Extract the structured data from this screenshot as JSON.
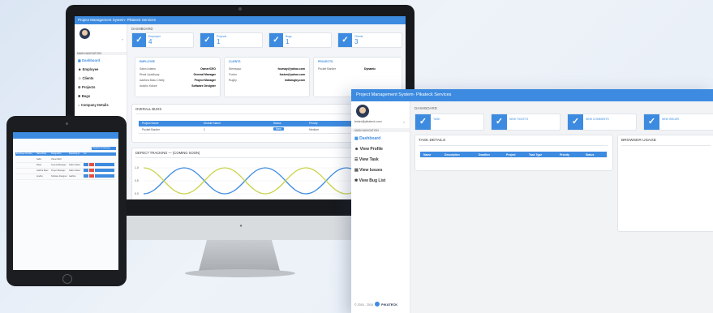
{
  "desktop": {
    "app_title": "Project Management System- Pikateck Services",
    "section": "DASHBOARD",
    "nav_header": "MAIN NAVIGATION",
    "nav": [
      "Dashboard",
      "Employee",
      "Clients",
      "Projects",
      "Bugs",
      "Company Details"
    ],
    "stats": [
      {
        "label": "Employee",
        "value": "4"
      },
      {
        "label": "Projects",
        "value": "1"
      },
      {
        "label": "Bugs",
        "value": "1"
      },
      {
        "label": "Clients",
        "value": "3"
      }
    ],
    "employee_card": {
      "title": "EMPLOYEE",
      "rows": [
        {
          "name": "Sabin Adams",
          "role": "Owner/CEO"
        },
        {
          "name": "Riwai Upadhyay",
          "role": "General Manager"
        },
        {
          "name": "Aadhira Basu Chelly",
          "role": "Project Manager"
        },
        {
          "name": "Aradhu Kalure",
          "role": "Software Designer"
        }
      ]
    },
    "clients_card": {
      "title": "CLIENTS",
      "rows": [
        {
          "name": "Stemsquo",
          "email": "foursay@yahoo.com"
        },
        {
          "name": "Fusion",
          "email": "fusion@yahoo.com"
        },
        {
          "name": "Rugby",
          "email": "indiarugby.com"
        }
      ]
    },
    "projects_card": {
      "title": "PROJECTS",
      "rows": [
        {
          "name": "Pocket Banker",
          "client": "Dynamic"
        }
      ]
    },
    "bugs": {
      "title": "OVERALL BUGS",
      "headers": [
        "Project Name",
        "Module Name",
        "Status",
        "Priority"
      ],
      "rows": [
        {
          "project": "Pocket Banker",
          "module": "1",
          "status": "New",
          "priority": "Medium"
        }
      ]
    },
    "defect_title": "DEFECT TRACKING — (COMING SOON)",
    "y_ticks": [
      "1.0",
      "0.5",
      "0.0"
    ]
  },
  "tablet": {
    "button": "Register Employee",
    "headers": [
      "Employee Number",
      "Name/Dept",
      "Designation",
      "Reporting to",
      "Act"
    ],
    "rows": [
      {
        "id": "",
        "name": "Sabin",
        "role": "Owner/CEO"
      },
      {
        "id": "",
        "name": "Riwai",
        "role": "General Manager",
        "rep": "Sabin Adams"
      },
      {
        "id": "",
        "name": "Aadhira Basu",
        "role": "Project Manager",
        "rep": "Sabin Adams"
      },
      {
        "id": "",
        "name": "Aradhu",
        "role": "Software Designer",
        "rep": "Aadhira"
      }
    ],
    "action_labels": [
      "Edit",
      "Del",
      "View/Assign Projects"
    ]
  },
  "browser": {
    "app_title": "Project Management System- Pikateck Services",
    "user_email": "tester@pikateck.com",
    "section": "DASHBOARD",
    "nav_header": "MAIN NAVIGATION",
    "nav": [
      "Dashboard",
      "View Profile",
      "View Task",
      "View Issues",
      "View Bug List"
    ],
    "stats": [
      "TASK",
      "NEW TICKETS",
      "NEW COMMENTS",
      "NEW ISSUES"
    ],
    "task_details": {
      "title": "TASK DETAILS",
      "headers": [
        "Name",
        "Description",
        "Deadline",
        "Project",
        "Task Type",
        "Priority",
        "Status"
      ]
    },
    "browser_usage_title": "BROWSER USAGE",
    "footer": "© 2016 - 2018",
    "footer_brand": "PIKATECK"
  },
  "colors": {
    "accent": "#3d8be0",
    "chart_blue": "#3d8be0",
    "chart_yellow": "#c9d24a"
  }
}
